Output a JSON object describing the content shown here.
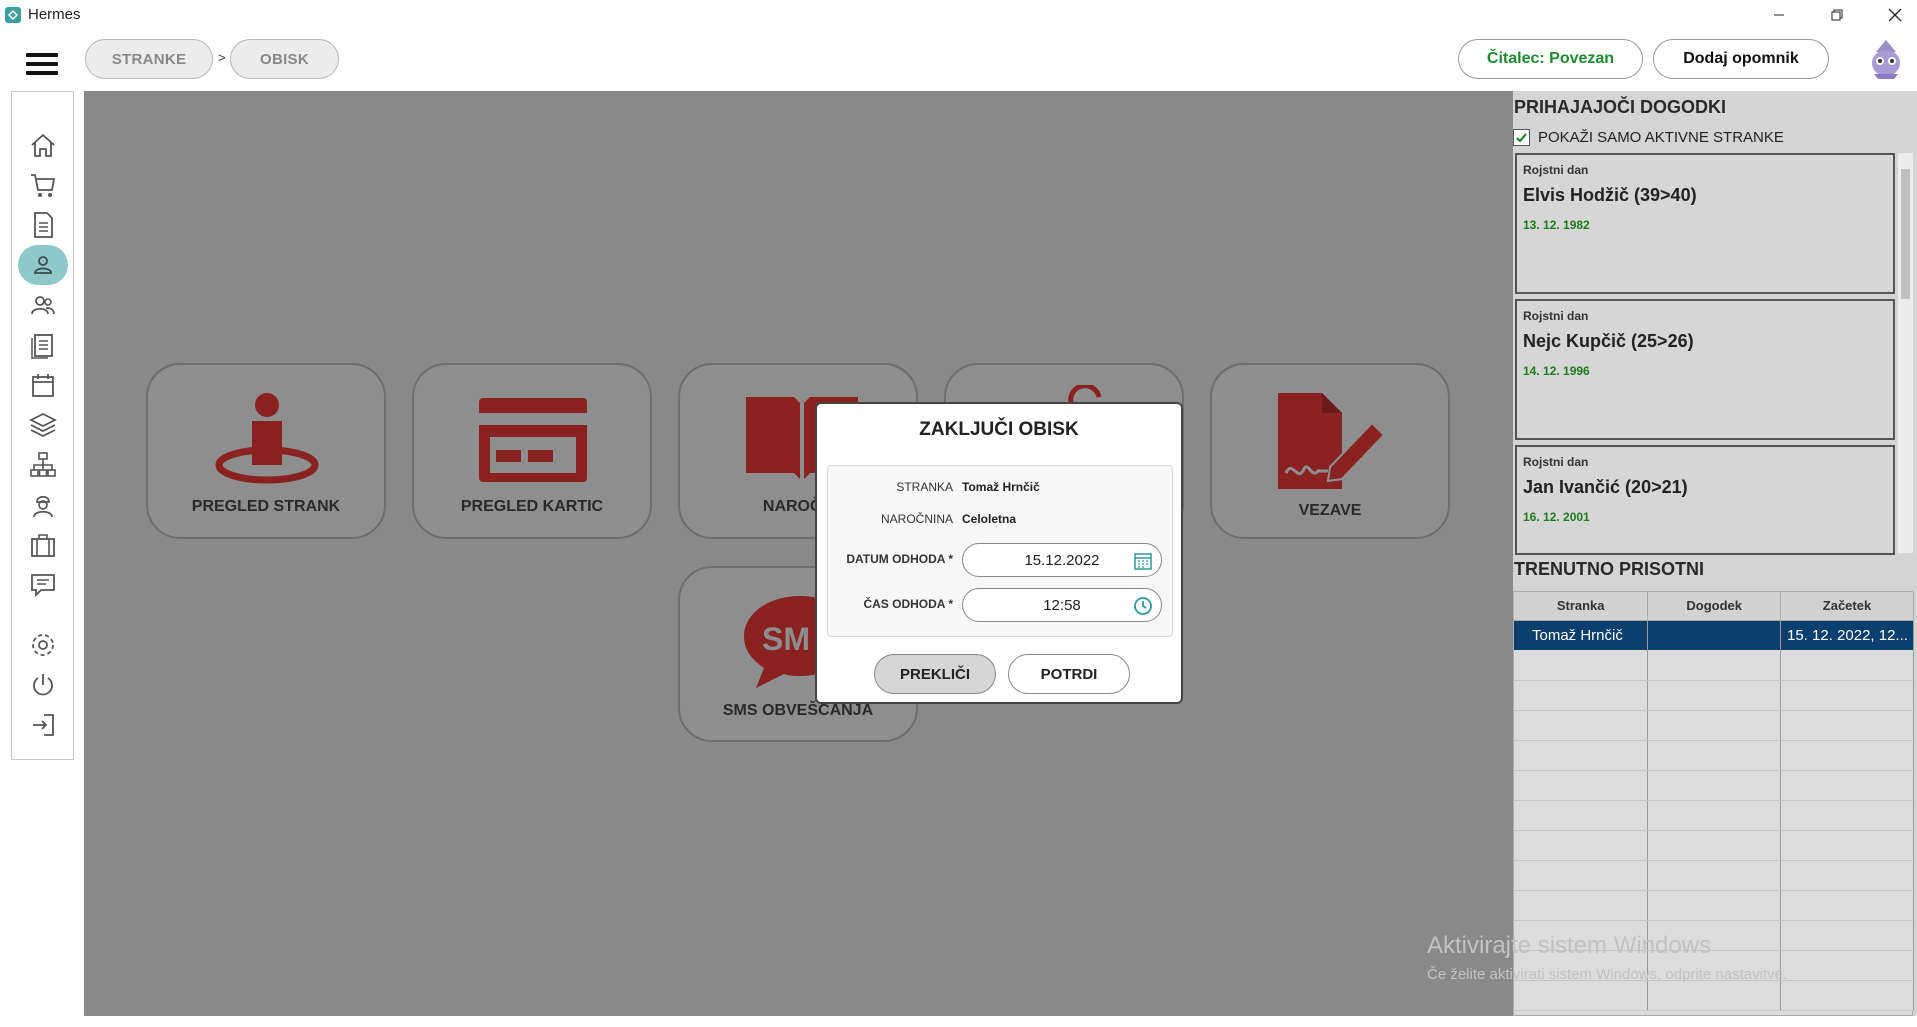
{
  "window": {
    "title": "Hermes",
    "controls": [
      "minimize-icon",
      "restore-icon",
      "close-icon"
    ]
  },
  "breadcrumb": [
    "STRANKE",
    "OBISK"
  ],
  "breadcrumb_separator": ">",
  "header": {
    "reader_status": "Čitalec: Povezan",
    "add_reminder": "Dodaj opomnik"
  },
  "sidebar": {
    "items": [
      "home-icon",
      "cart-icon",
      "document-icon",
      "person-icon",
      "people-icon",
      "list-icon",
      "calendar-icon",
      "layers-icon",
      "network-icon",
      "worker-icon",
      "briefcase-icon",
      "message-icon",
      "settings-icon",
      "power-icon",
      "logout-icon"
    ],
    "active": "person-icon"
  },
  "tiles": {
    "pregled_strank": "PREGLED STRANK",
    "pregled_kartic": "PREGLED KARTIC",
    "narocnine": "NAROČN",
    "vezave": "VEZAVE",
    "sms": "SMS OBVEŠČANJA",
    "sms_icon_text": "SM"
  },
  "modal": {
    "title": "ZAKLJUČI OBISK",
    "stranka_label": "STRANKA",
    "stranka_value": "Tomaž Hrnčič",
    "narocnina_label": "NAROČNINA",
    "narocnina_value": "Celoletna",
    "datum_label": "DATUM ODHODA *",
    "datum_value": "15.12.2022",
    "cas_label": "ČAS ODHODA *",
    "cas_value": "12:58",
    "cancel": "PREKLIČI",
    "confirm": "POTRDI"
  },
  "events": {
    "title": "PRIHAJAJOČI DOGODKI",
    "filter_label": "POKAŽI SAMO AKTIVNE STRANKE",
    "filter_checked": true,
    "items": [
      {
        "type": "Rojstni dan",
        "name": "Elvis Hodžič (39>40)",
        "date": "13. 12. 1982"
      },
      {
        "type": "Rojstni dan",
        "name": "Nejc Kupčič (25>26)",
        "date": "14. 12. 1996"
      },
      {
        "type": "Rojstni dan",
        "name": "Jan Ivančić (20>21)",
        "date": "16. 12. 2001"
      }
    ]
  },
  "present": {
    "title": "TRENUTNO PRISOTNI",
    "columns": [
      "Stranka",
      "Dogodek",
      "Začetek"
    ],
    "rows": [
      [
        "Tomaž Hrnčič",
        "",
        "15. 12. 2022, 12..."
      ]
    ]
  },
  "watermark": {
    "line1": "Aktivirajte sistem Windows",
    "line2": "Če želite aktivirati sistem Windows, odprite nastavitve."
  },
  "colors": {
    "accent_red": "#8b2222",
    "teal": "#2a9a9a",
    "selection": "#0a3f6e",
    "date_green": "#1e7a1e"
  }
}
